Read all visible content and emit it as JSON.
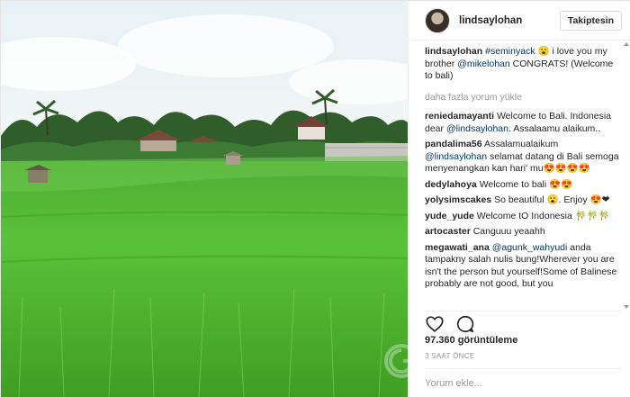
{
  "header": {
    "username": "lindsaylohan",
    "follow_label": "Takiptesin"
  },
  "caption": {
    "user": "lindsaylohan",
    "tag": "#seminyack",
    "text1": " 😮 i love you my brother ",
    "mention": "@mikelohan",
    "text2": " CONGRATS! (Welcome to bali)"
  },
  "load_more": "daha fazla yorum yükle",
  "comments": [
    {
      "user": "reniedamayanti",
      "pre": " Welcome to Bali. Indonesia dear ",
      "mention": "@lindsaylohan",
      "post": ". Assalaamu alaikum.."
    },
    {
      "user": "pandalima56",
      "pre": " Assalamualaikum ",
      "mention": "@lindsaylohan",
      "post": " selamat datang di Bali semoga menyenangkan kan hari' mu😍😍😍😍"
    },
    {
      "user": "dedylahoya",
      "pre": " Welcome to bali 😍😍",
      "mention": "",
      "post": ""
    },
    {
      "user": "yolysimscakes",
      "pre": " So beautiful 😮. Enjoy 😍❤",
      "mention": "",
      "post": ""
    },
    {
      "user": "yude_yude",
      "pre": " Welcome tO Indonesia 🎋🎋🎋",
      "mention": "",
      "post": ""
    },
    {
      "user": "artocaster",
      "pre": " Canguuu yeaahh",
      "mention": "",
      "post": ""
    },
    {
      "user": "megawati_ana",
      "pre": " ",
      "mention": "@agunk_wahyudi",
      "post": " anda tampakny salah nulis bung!Wherever you are isn't the person but yourself!Some of Balinese probably are not good, but you"
    }
  ],
  "views": "97.360 görüntüleme",
  "time": "3 SAAT ÖNCE",
  "comment_input": {
    "placeholder": "Yorum ekle..."
  },
  "icons": {
    "like": "heart-icon",
    "comment": "comment-bubble-icon"
  }
}
